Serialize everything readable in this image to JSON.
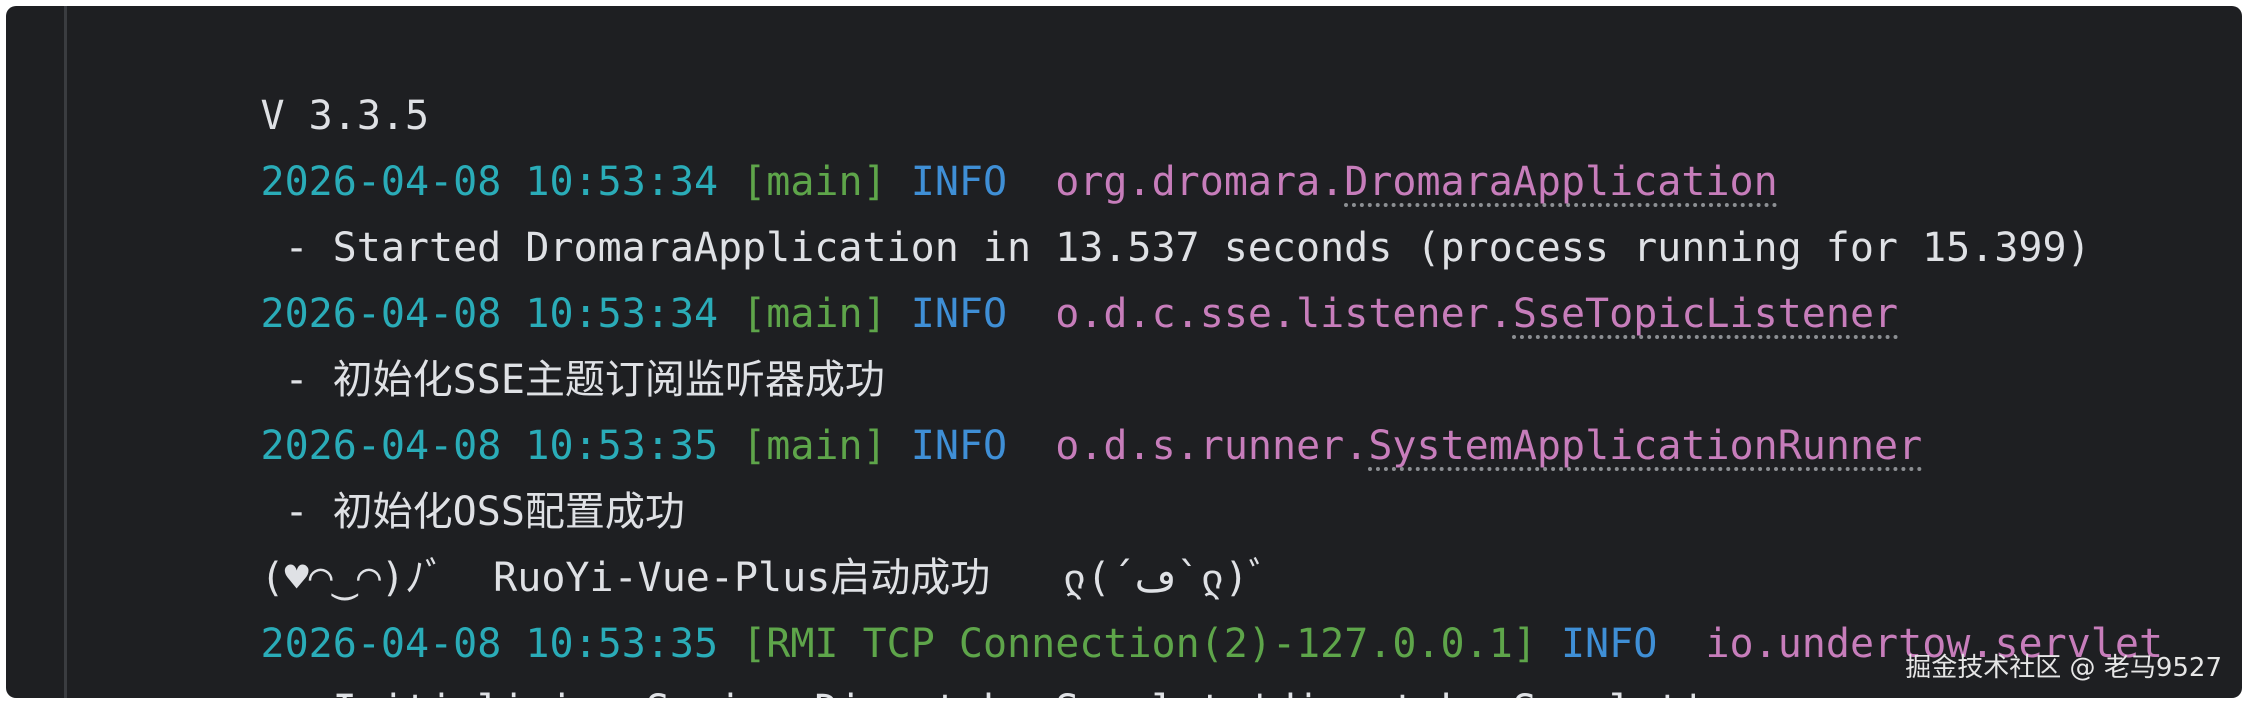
{
  "console": {
    "lines": [
      {
        "type": "text",
        "text": "V 3.3.5"
      },
      {
        "type": "log",
        "timestamp": "2026-04-08 10:53:34",
        "thread": "[main]",
        "level": "INFO",
        "logger_pkg": "org.dromara.",
        "logger_class": "DromaraApplication"
      },
      {
        "type": "message",
        "text": "- Started DromaraApplication in 13.537 seconds (process running for 15.399)"
      },
      {
        "type": "log",
        "timestamp": "2026-04-08 10:53:34",
        "thread": "[main]",
        "level": "INFO",
        "logger_pkg": "o.d.c.sse.listener.",
        "logger_class": "SseTopicListener"
      },
      {
        "type": "message",
        "text": "- 初始化SSE主题订阅监听器成功"
      },
      {
        "type": "log",
        "timestamp": "2026-04-08 10:53:35",
        "thread": "[main]",
        "level": "INFO",
        "logger_pkg": "o.d.s.runner.",
        "logger_class": "SystemApplicationRunner"
      },
      {
        "type": "message",
        "text": "- 初始化OSS配置成功"
      },
      {
        "type": "text",
        "text": "(♥◠‿◠)ﾉﾞ  RuoYi-Vue-Plus启动成功   ლ(´ڡ`ლ)ﾞ"
      },
      {
        "type": "log",
        "timestamp": "2026-04-08 10:53:35",
        "thread": "[RMI TCP Connection(2)-127.0.0.1]",
        "level": "INFO",
        "logger_pkg": "io.undertow.servlet",
        "logger_class": ""
      },
      {
        "type": "message",
        "text": "- Initializing Spring DispatcherServlet 'dispatcherServlet'"
      }
    ]
  },
  "watermark": "掘金技术社区 @ 老马9527",
  "colors": {
    "background": "#1e1f22",
    "timestamp": "#2aacb8",
    "thread": "#5ea54a",
    "level": "#3f8fd6",
    "logger": "#c77dbb",
    "text": "#dfe1e5"
  }
}
